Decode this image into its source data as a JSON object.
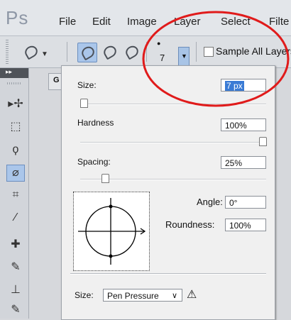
{
  "app": {
    "logo": "Ps"
  },
  "menu": {
    "items": [
      "File",
      "Edit",
      "Image",
      "Layer",
      "Select",
      "Filte"
    ]
  },
  "options_bar": {
    "brush_size_value": "7",
    "sample_all_layers_label": "Sample All Layers",
    "sample_all_layers_checked": false
  },
  "panel": {
    "tab_label": "G",
    "size_label": "Size:",
    "size_value": "7 px",
    "size_slider": 0.0,
    "hardness_label": "Hardness",
    "hardness_value": "100%",
    "hardness_slider": 1.0,
    "spacing_label": "Spacing:",
    "spacing_value": "25%",
    "spacing_slider": 0.12,
    "angle_label": "Angle:",
    "angle_value": "0°",
    "roundness_label": "Roundness:",
    "roundness_value": "100%",
    "size_control_label": "Size:",
    "size_control_value": "Pen Pressure",
    "warning_icon": "⚠"
  },
  "colors": {
    "annotation": "#e01b1b",
    "active_tool": "#aac6ea"
  }
}
